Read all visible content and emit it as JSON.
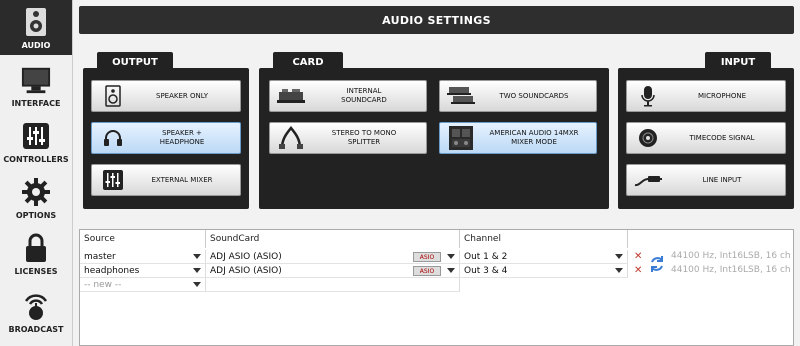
{
  "sidebar": {
    "items": [
      {
        "label": "AUDIO",
        "icon": "speaker-icon"
      },
      {
        "label": "INTERFACE",
        "icon": "monitor-icon"
      },
      {
        "label": "CONTROLLERS",
        "icon": "mixer-icon"
      },
      {
        "label": "OPTIONS",
        "icon": "gear-icon"
      },
      {
        "label": "LICENSES",
        "icon": "lock-icon"
      },
      {
        "label": "BROADCAST",
        "icon": "broadcast-icon"
      }
    ]
  },
  "header": {
    "title": "AUDIO SETTINGS"
  },
  "output": {
    "tab": "OUTPUT",
    "buttons": [
      {
        "label": "SPEAKER ONLY",
        "icon": "speaker-icon"
      },
      {
        "label": "SPEAKER +\nHEADPHONE",
        "icon": "headphone-icon"
      },
      {
        "label": "EXTERNAL MIXER",
        "icon": "mixer-icon"
      }
    ]
  },
  "card": {
    "tab": "CARD",
    "buttons": [
      {
        "label": "INTERNAL\nSOUNDCARD",
        "icon": "soundcard-icon"
      },
      {
        "label": "TWO SOUNDCARDS",
        "icon": "two-soundcards-icon"
      },
      {
        "label": "STEREO TO MONO\nSPLITTER",
        "icon": "splitter-cable-icon"
      },
      {
        "label": "AMERICAN AUDIO 14MXR\nMIXER MODE",
        "icon": "mixer-device-icon"
      }
    ]
  },
  "input": {
    "tab": "INPUT",
    "buttons": [
      {
        "label": "MICROPHONE",
        "icon": "microphone-icon"
      },
      {
        "label": "TIMECODE SIGNAL",
        "icon": "vinyl-icon"
      },
      {
        "label": "LINE INPUT",
        "icon": "cable-icon"
      }
    ]
  },
  "table": {
    "headers": {
      "source": "Source",
      "soundcard": "SoundCard",
      "channel": "Channel"
    },
    "rows": [
      {
        "source": "master",
        "soundcard": "ADJ ASIO (ASIO)",
        "badge": "ASIO",
        "channel": "Out 1 & 2",
        "info": "44100 Hz, Int16LSB, 16 ch"
      },
      {
        "source": "headphones",
        "soundcard": "ADJ ASIO (ASIO)",
        "badge": "ASIO",
        "channel": "Out 3 & 4",
        "info": "44100 Hz, Int16LSB, 16 ch"
      }
    ],
    "new_row": "-- new --"
  },
  "colors": {
    "accent_active": "#bcd9f5",
    "panel": "#222222",
    "delete": "#c0392b"
  }
}
